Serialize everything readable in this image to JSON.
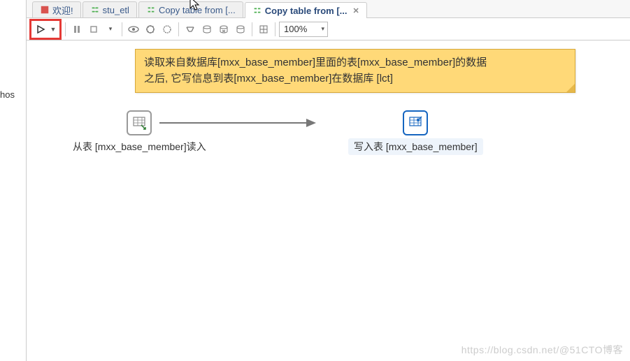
{
  "left_panel": {
    "truncated_label": "hos"
  },
  "tabs": [
    {
      "label": "欢迎!",
      "icon": "welcome-icon"
    },
    {
      "label": "stu_etl",
      "icon": "trans-icon"
    },
    {
      "label": "Copy table from [...",
      "icon": "trans-icon"
    },
    {
      "label": "Copy table from [...",
      "icon": "trans-icon",
      "active": true,
      "closeable": true
    }
  ],
  "toolbar": {
    "zoom": "100%",
    "items": [
      "run",
      "run-options",
      "pause",
      "stop",
      "preview",
      "debug",
      "debug-step",
      "sql",
      "db-explore",
      "db-clean",
      "db-sync",
      "grid"
    ]
  },
  "note": {
    "line1": "读取来自数据库[mxx_base_member]里面的表[mxx_base_member]的数据",
    "line2": "之后, 它写信息到表[mxx_base_member]在数据库 [lct]"
  },
  "steps": {
    "source": {
      "label": "从表 [mxx_base_member]读入"
    },
    "target": {
      "label": "写入表 [mxx_base_member]",
      "selected": true
    }
  },
  "watermark": "https://blog.csdn.net/@51CTO博客"
}
